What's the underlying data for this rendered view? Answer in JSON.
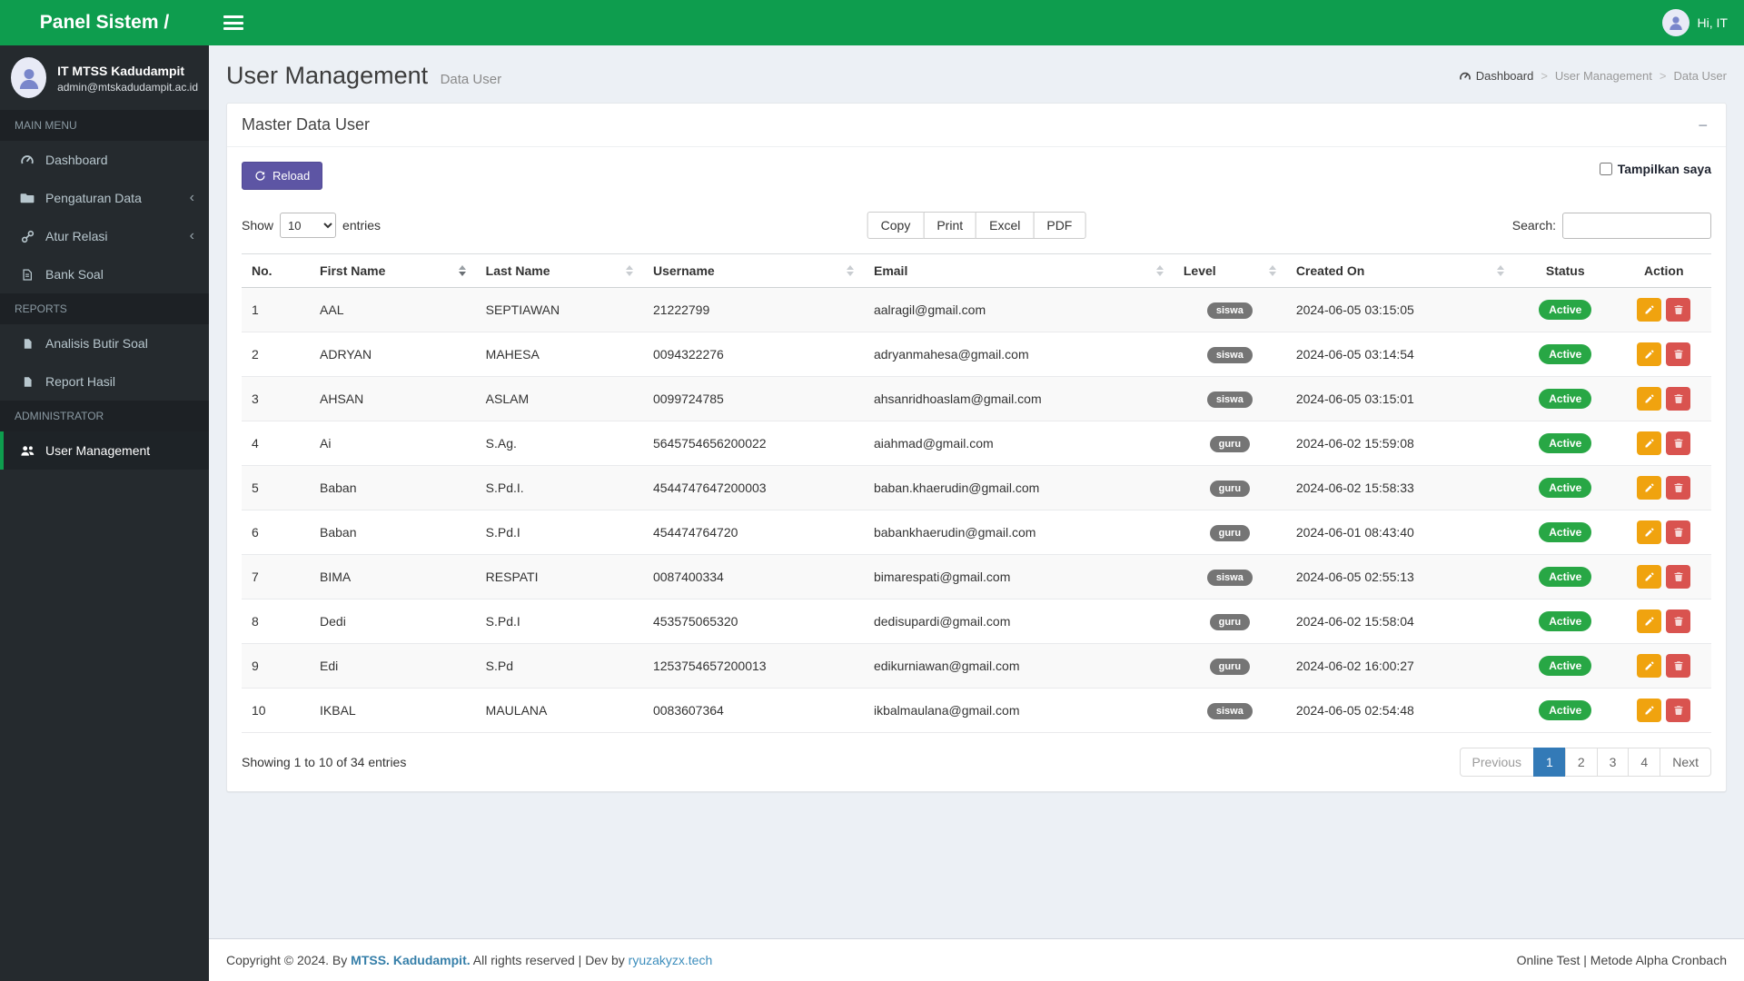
{
  "brand": {
    "title": "Panel Sistem /"
  },
  "topbar": {
    "greeting": "Hi, IT"
  },
  "sidebar": {
    "user": {
      "name": "IT MTSS Kadudampit",
      "email": "admin@mtskadudampit.ac.id"
    },
    "sections": [
      {
        "header": "MAIN MENU",
        "items": [
          {
            "label": "Dashboard"
          },
          {
            "label": "Pengaturan Data"
          },
          {
            "label": "Atur Relasi"
          },
          {
            "label": "Bank Soal"
          }
        ]
      },
      {
        "header": "REPORTS",
        "items": [
          {
            "label": "Analisis Butir Soal"
          },
          {
            "label": "Report Hasil"
          }
        ]
      },
      {
        "header": "ADMINISTRATOR",
        "items": [
          {
            "label": "User Management"
          }
        ]
      }
    ]
  },
  "content_header": {
    "title": "User Management",
    "subtitle": "Data User",
    "breadcrumb": [
      "Dashboard",
      "User Management",
      "Data User"
    ]
  },
  "card": {
    "title": "Master Data User",
    "collapse_icon": "−",
    "reload_label": "Reload",
    "show_checkbox_label": "Tampilkan saya",
    "datatable": {
      "show_label": "Show",
      "entries_label": "entries",
      "page_length": "10",
      "export_buttons": [
        "Copy",
        "Print",
        "Excel",
        "PDF"
      ],
      "search_label": "Search:",
      "columns": [
        "No.",
        "First Name",
        "Last Name",
        "Username",
        "Email",
        "Level",
        "Created On",
        "Status",
        "Action"
      ],
      "rows": [
        {
          "no": "1",
          "first": "AAL",
          "last": "SEPTIAWAN",
          "username": "21222799",
          "email": "aalragil@gmail.com",
          "level": "siswa",
          "created": "2024-06-05 03:15:05",
          "status": "Active"
        },
        {
          "no": "2",
          "first": "ADRYAN",
          "last": "MAHESA",
          "username": "0094322276",
          "email": "adryanmahesa@gmail.com",
          "level": "siswa",
          "created": "2024-06-05 03:14:54",
          "status": "Active"
        },
        {
          "no": "3",
          "first": "AHSAN",
          "last": "ASLAM",
          "username": "0099724785",
          "email": "ahsanridhoaslam@gmail.com",
          "level": "siswa",
          "created": "2024-06-05 03:15:01",
          "status": "Active"
        },
        {
          "no": "4",
          "first": "Ai",
          "last": "S.Ag.",
          "username": "5645754656200022",
          "email": "aiahmad@gmail.com",
          "level": "guru",
          "created": "2024-06-02 15:59:08",
          "status": "Active"
        },
        {
          "no": "5",
          "first": "Baban",
          "last": "S.Pd.I.",
          "username": "4544747647200003",
          "email": "baban.khaerudin@gmail.com",
          "level": "guru",
          "created": "2024-06-02 15:58:33",
          "status": "Active"
        },
        {
          "no": "6",
          "first": "Baban",
          "last": "S.Pd.I",
          "username": "454474764720",
          "email": "babankhaerudin@gmail.com",
          "level": "guru",
          "created": "2024-06-01 08:43:40",
          "status": "Active"
        },
        {
          "no": "7",
          "first": "BIMA",
          "last": "RESPATI",
          "username": "0087400334",
          "email": "bimarespati@gmail.com",
          "level": "siswa",
          "created": "2024-06-05 02:55:13",
          "status": "Active"
        },
        {
          "no": "8",
          "first": "Dedi",
          "last": "S.Pd.I",
          "username": "453575065320",
          "email": "dedisupardi@gmail.com",
          "level": "guru",
          "created": "2024-06-02 15:58:04",
          "status": "Active"
        },
        {
          "no": "9",
          "first": "Edi",
          "last": "S.Pd",
          "username": "1253754657200013",
          "email": "edikurniawan@gmail.com",
          "level": "guru",
          "created": "2024-06-02 16:00:27",
          "status": "Active"
        },
        {
          "no": "10",
          "first": "IKBAL",
          "last": "MAULANA",
          "username": "0083607364",
          "email": "ikbalmaulana@gmail.com",
          "level": "siswa",
          "created": "2024-06-05 02:54:48",
          "status": "Active"
        }
      ],
      "info": "Showing 1 to 10 of 34 entries",
      "pagination": {
        "previous": "Previous",
        "pages": [
          "1",
          "2",
          "3",
          "4"
        ],
        "active": "1",
        "next": "Next"
      }
    }
  },
  "footer": {
    "copyright_prefix": "Copyright © 2024. By ",
    "brand_link": "MTSS. Kadudampit.",
    "middle": " All rights reserved | Dev by ",
    "dev_link": "ryuzakyzx.tech",
    "right": "Online Test | Metode Alpha Cronbach"
  },
  "colors": {
    "navbar_green": "#0e9d4e",
    "sidebar_dark": "#252a2e",
    "reload_purple": "#5d55a4",
    "status_green": "#28a745",
    "level_gray": "#757575",
    "edit_orange": "#f0a30f",
    "delete_red": "#d9534f",
    "pagination_blue": "#337ab7",
    "link_blue": "#3c8dbc"
  }
}
